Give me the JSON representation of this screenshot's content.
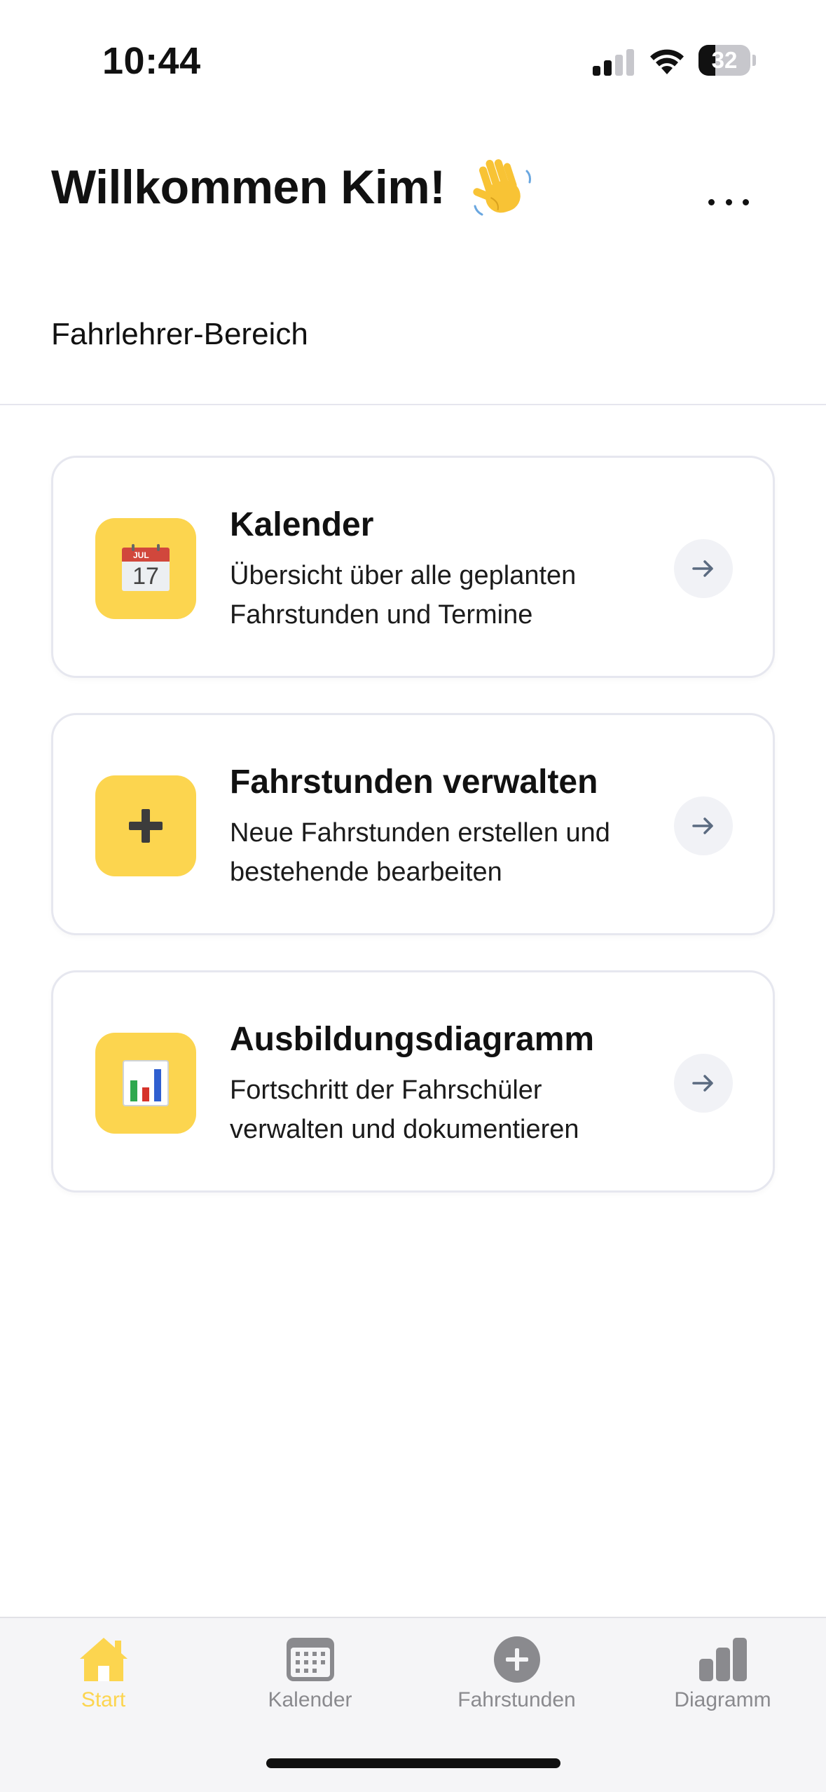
{
  "status_bar": {
    "time": "10:44",
    "battery_percent": "32",
    "battery_level": 0.32
  },
  "header": {
    "welcome_text": "Willkommen Kim!",
    "wave_icon": "waving-hand-icon",
    "more_icon": "more-dots-icon",
    "section_label": "Fahrlehrer-Bereich"
  },
  "cards": [
    {
      "icon": "calendar-icon",
      "calendar_month": "JUL",
      "calendar_day": "17",
      "title": "Kalender",
      "desc_line1": "Übersicht über alle geplanten",
      "desc_line2": "Fahrstunden und Termine"
    },
    {
      "icon": "plus-icon",
      "title": "Fahrstunden verwalten",
      "desc_line1": "Neue Fahrstunden erstellen und",
      "desc_line2": "bestehende bearbeiten"
    },
    {
      "icon": "bar-chart-icon",
      "title": "Ausbildungsdiagramm",
      "desc_line1": "Fortschritt der Fahrschüler",
      "desc_line2": "verwalten und dokumentieren"
    }
  ],
  "tabs": [
    {
      "label": "Start",
      "icon": "home-icon",
      "active": true
    },
    {
      "label": "Kalender",
      "icon": "calendar-icon",
      "active": false
    },
    {
      "label": "Fahrstunden",
      "icon": "plus-circle-icon",
      "active": false
    },
    {
      "label": "Diagramm",
      "icon": "bar-chart-icon",
      "active": false
    }
  ],
  "colors": {
    "accent_yellow": "#fcd54f",
    "tab_inactive": "#8a8a8e",
    "card_border": "#e6e7ef",
    "arrow_circle": "#f1f2f6",
    "arrow_color": "#5b6b80"
  }
}
